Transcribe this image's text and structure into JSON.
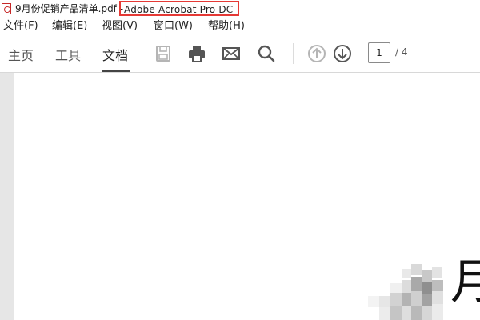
{
  "title_bar": {
    "document_name": "9月份促销产品清单.pdf -",
    "app_name": "Adobe Acrobat Pro DC",
    "icon": "pdf-file-icon"
  },
  "menu": {
    "items": [
      {
        "label": "文件(F)"
      },
      {
        "label": "编辑(E)"
      },
      {
        "label": "视图(V)"
      },
      {
        "label": "窗口(W)"
      },
      {
        "label": "帮助(H)"
      }
    ]
  },
  "toolbar": {
    "tabs": [
      {
        "label": "主页"
      },
      {
        "label": "工具"
      },
      {
        "label": "文档",
        "active": true
      }
    ],
    "icons": [
      "save-icon",
      "print-icon",
      "email-icon",
      "search-icon",
      "page-up-icon",
      "page-down-icon"
    ],
    "current_page": "1",
    "total_pages": "/ 4"
  },
  "document": {
    "visible_char": "月"
  },
  "colors": {
    "annotation_red": "#e53935",
    "active_tab_underline": "#444444",
    "icon_gray": "#555555",
    "disabled_gray": "#b5b5b5"
  }
}
